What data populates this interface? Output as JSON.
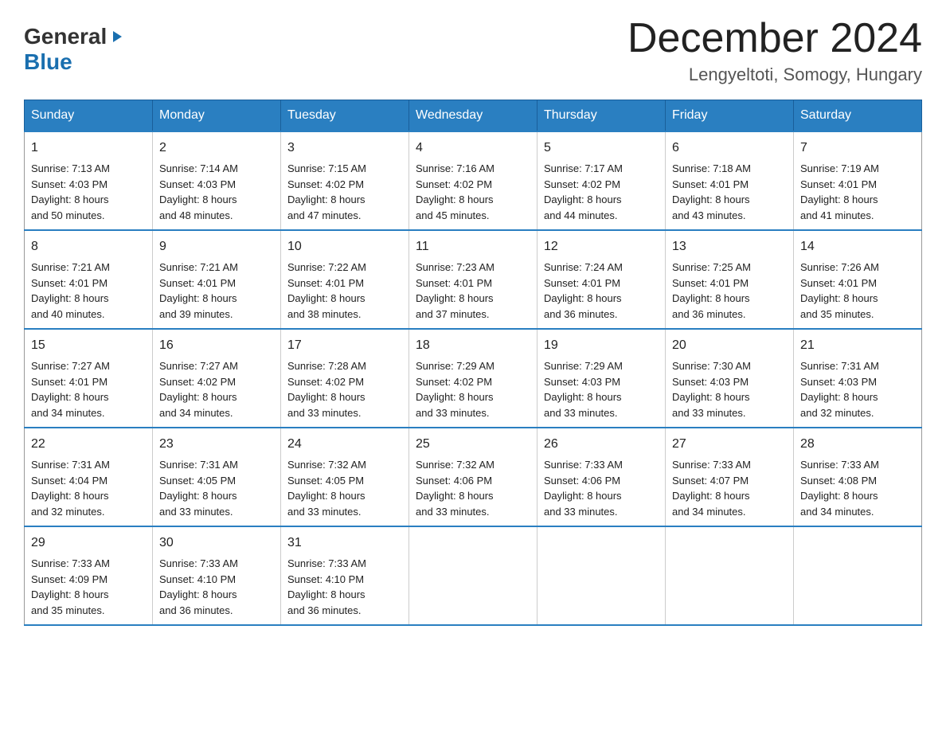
{
  "header": {
    "logo_general": "General",
    "logo_blue": "Blue",
    "month_title": "December 2024",
    "location": "Lengyeltoti, Somogy, Hungary"
  },
  "days_of_week": [
    "Sunday",
    "Monday",
    "Tuesday",
    "Wednesday",
    "Thursday",
    "Friday",
    "Saturday"
  ],
  "weeks": [
    [
      {
        "day": "1",
        "sunrise": "Sunrise: 7:13 AM",
        "sunset": "Sunset: 4:03 PM",
        "daylight": "Daylight: 8 hours",
        "daylight2": "and 50 minutes."
      },
      {
        "day": "2",
        "sunrise": "Sunrise: 7:14 AM",
        "sunset": "Sunset: 4:03 PM",
        "daylight": "Daylight: 8 hours",
        "daylight2": "and 48 minutes."
      },
      {
        "day": "3",
        "sunrise": "Sunrise: 7:15 AM",
        "sunset": "Sunset: 4:02 PM",
        "daylight": "Daylight: 8 hours",
        "daylight2": "and 47 minutes."
      },
      {
        "day": "4",
        "sunrise": "Sunrise: 7:16 AM",
        "sunset": "Sunset: 4:02 PM",
        "daylight": "Daylight: 8 hours",
        "daylight2": "and 45 minutes."
      },
      {
        "day": "5",
        "sunrise": "Sunrise: 7:17 AM",
        "sunset": "Sunset: 4:02 PM",
        "daylight": "Daylight: 8 hours",
        "daylight2": "and 44 minutes."
      },
      {
        "day": "6",
        "sunrise": "Sunrise: 7:18 AM",
        "sunset": "Sunset: 4:01 PM",
        "daylight": "Daylight: 8 hours",
        "daylight2": "and 43 minutes."
      },
      {
        "day": "7",
        "sunrise": "Sunrise: 7:19 AM",
        "sunset": "Sunset: 4:01 PM",
        "daylight": "Daylight: 8 hours",
        "daylight2": "and 41 minutes."
      }
    ],
    [
      {
        "day": "8",
        "sunrise": "Sunrise: 7:21 AM",
        "sunset": "Sunset: 4:01 PM",
        "daylight": "Daylight: 8 hours",
        "daylight2": "and 40 minutes."
      },
      {
        "day": "9",
        "sunrise": "Sunrise: 7:21 AM",
        "sunset": "Sunset: 4:01 PM",
        "daylight": "Daylight: 8 hours",
        "daylight2": "and 39 minutes."
      },
      {
        "day": "10",
        "sunrise": "Sunrise: 7:22 AM",
        "sunset": "Sunset: 4:01 PM",
        "daylight": "Daylight: 8 hours",
        "daylight2": "and 38 minutes."
      },
      {
        "day": "11",
        "sunrise": "Sunrise: 7:23 AM",
        "sunset": "Sunset: 4:01 PM",
        "daylight": "Daylight: 8 hours",
        "daylight2": "and 37 minutes."
      },
      {
        "day": "12",
        "sunrise": "Sunrise: 7:24 AM",
        "sunset": "Sunset: 4:01 PM",
        "daylight": "Daylight: 8 hours",
        "daylight2": "and 36 minutes."
      },
      {
        "day": "13",
        "sunrise": "Sunrise: 7:25 AM",
        "sunset": "Sunset: 4:01 PM",
        "daylight": "Daylight: 8 hours",
        "daylight2": "and 36 minutes."
      },
      {
        "day": "14",
        "sunrise": "Sunrise: 7:26 AM",
        "sunset": "Sunset: 4:01 PM",
        "daylight": "Daylight: 8 hours",
        "daylight2": "and 35 minutes."
      }
    ],
    [
      {
        "day": "15",
        "sunrise": "Sunrise: 7:27 AM",
        "sunset": "Sunset: 4:01 PM",
        "daylight": "Daylight: 8 hours",
        "daylight2": "and 34 minutes."
      },
      {
        "day": "16",
        "sunrise": "Sunrise: 7:27 AM",
        "sunset": "Sunset: 4:02 PM",
        "daylight": "Daylight: 8 hours",
        "daylight2": "and 34 minutes."
      },
      {
        "day": "17",
        "sunrise": "Sunrise: 7:28 AM",
        "sunset": "Sunset: 4:02 PM",
        "daylight": "Daylight: 8 hours",
        "daylight2": "and 33 minutes."
      },
      {
        "day": "18",
        "sunrise": "Sunrise: 7:29 AM",
        "sunset": "Sunset: 4:02 PM",
        "daylight": "Daylight: 8 hours",
        "daylight2": "and 33 minutes."
      },
      {
        "day": "19",
        "sunrise": "Sunrise: 7:29 AM",
        "sunset": "Sunset: 4:03 PM",
        "daylight": "Daylight: 8 hours",
        "daylight2": "and 33 minutes."
      },
      {
        "day": "20",
        "sunrise": "Sunrise: 7:30 AM",
        "sunset": "Sunset: 4:03 PM",
        "daylight": "Daylight: 8 hours",
        "daylight2": "and 33 minutes."
      },
      {
        "day": "21",
        "sunrise": "Sunrise: 7:31 AM",
        "sunset": "Sunset: 4:03 PM",
        "daylight": "Daylight: 8 hours",
        "daylight2": "and 32 minutes."
      }
    ],
    [
      {
        "day": "22",
        "sunrise": "Sunrise: 7:31 AM",
        "sunset": "Sunset: 4:04 PM",
        "daylight": "Daylight: 8 hours",
        "daylight2": "and 32 minutes."
      },
      {
        "day": "23",
        "sunrise": "Sunrise: 7:31 AM",
        "sunset": "Sunset: 4:05 PM",
        "daylight": "Daylight: 8 hours",
        "daylight2": "and 33 minutes."
      },
      {
        "day": "24",
        "sunrise": "Sunrise: 7:32 AM",
        "sunset": "Sunset: 4:05 PM",
        "daylight": "Daylight: 8 hours",
        "daylight2": "and 33 minutes."
      },
      {
        "day": "25",
        "sunrise": "Sunrise: 7:32 AM",
        "sunset": "Sunset: 4:06 PM",
        "daylight": "Daylight: 8 hours",
        "daylight2": "and 33 minutes."
      },
      {
        "day": "26",
        "sunrise": "Sunrise: 7:33 AM",
        "sunset": "Sunset: 4:06 PM",
        "daylight": "Daylight: 8 hours",
        "daylight2": "and 33 minutes."
      },
      {
        "day": "27",
        "sunrise": "Sunrise: 7:33 AM",
        "sunset": "Sunset: 4:07 PM",
        "daylight": "Daylight: 8 hours",
        "daylight2": "and 34 minutes."
      },
      {
        "day": "28",
        "sunrise": "Sunrise: 7:33 AM",
        "sunset": "Sunset: 4:08 PM",
        "daylight": "Daylight: 8 hours",
        "daylight2": "and 34 minutes."
      }
    ],
    [
      {
        "day": "29",
        "sunrise": "Sunrise: 7:33 AM",
        "sunset": "Sunset: 4:09 PM",
        "daylight": "Daylight: 8 hours",
        "daylight2": "and 35 minutes."
      },
      {
        "day": "30",
        "sunrise": "Sunrise: 7:33 AM",
        "sunset": "Sunset: 4:10 PM",
        "daylight": "Daylight: 8 hours",
        "daylight2": "and 36 minutes."
      },
      {
        "day": "31",
        "sunrise": "Sunrise: 7:33 AM",
        "sunset": "Sunset: 4:10 PM",
        "daylight": "Daylight: 8 hours",
        "daylight2": "and 36 minutes."
      },
      null,
      null,
      null,
      null
    ]
  ]
}
